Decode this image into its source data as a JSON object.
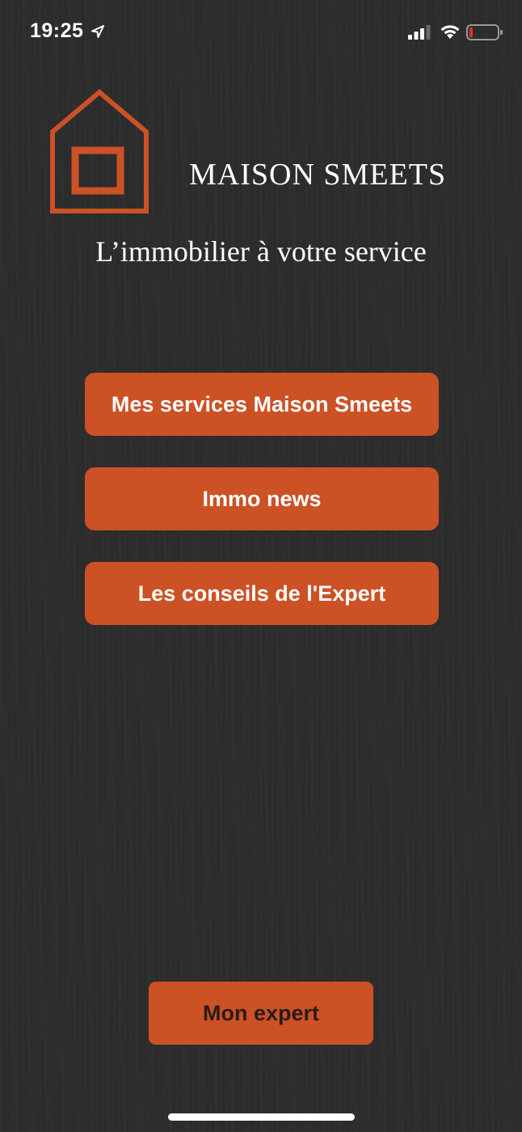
{
  "status_bar": {
    "time": "19:25",
    "icons": [
      "location-arrow-icon",
      "cellular-signal-icon",
      "wifi-icon",
      "battery-low-icon"
    ],
    "battery_level_color": "#e0342c"
  },
  "brand": {
    "name": "MAISON SMEETS",
    "tagline": "L’immobilier à votre service",
    "logo_icon": "house-icon",
    "accent_color": "#cc5125"
  },
  "menu": {
    "services_label": "Mes services Maison Smeets",
    "news_label": "Immo news",
    "conseils_label": "Les conseils de l'Expert"
  },
  "footer": {
    "expert_label": "Mon expert"
  }
}
